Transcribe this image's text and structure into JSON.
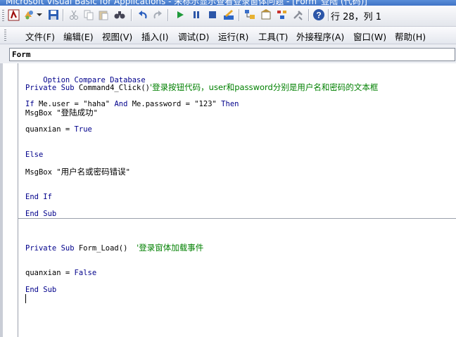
{
  "window": {
    "title": "Microsoft Visual Basic for Applications - 未标示显示查看登录窗体问题 - [Form_登陆 (代码)]"
  },
  "toolbar": {
    "position_text": "行 28，列 1"
  },
  "menubar": {
    "items": [
      "文件(F)",
      "编辑(E)",
      "视图(V)",
      "插入(I)",
      "调试(D)",
      "运行(R)",
      "工具(T)",
      "外接程序(A)",
      "窗口(W)",
      "帮助(H)"
    ]
  },
  "object_box": {
    "value": "Form"
  },
  "code": {
    "l1_kw": "Option Compare Database",
    "l2_kw": "Private Sub ",
    "l2_txt": "Command4_Click()",
    "l2_cm": "'登录按钮代码，user和password分别是用户名和密码的文本框",
    "l3_kw1": "If ",
    "l3_txt1": "Me.user = \"haha\" ",
    "l3_kw2": "And ",
    "l3_txt2": "Me.password = \"123\" ",
    "l3_kw3": "Then",
    "l4_txt": "MsgBox \"",
    "l4_cn": "登陆成功",
    "l4_end": "\"",
    "l5_txt": "quanxian = ",
    "l5_kw": "True",
    "l6_kw": "Else",
    "l7_txt": "MsgBox \"",
    "l7_cn": "用户名或密码错误",
    "l7_end": "\"",
    "l8_kw": "End If",
    "l9_kw": "End Sub",
    "l10_kw": "Private Sub ",
    "l10_txt": "Form_Load()",
    "l10_cm": "'登录窗体加载事件",
    "l11_txt": "quanxian = ",
    "l11_kw": "False",
    "l12_kw": "End Sub"
  }
}
